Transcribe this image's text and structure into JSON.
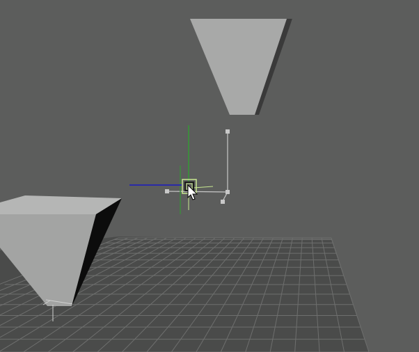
{
  "viewport": {
    "background_color": "#5c5d5c",
    "grid_color": "#4a4b4a",
    "grid_line_color": "#6e6f6e",
    "mesh_face_color": "#a5a6a5",
    "mesh_shadow_color": "#0c0c0c",
    "manipulator_highlight_color": "#c8e890",
    "manipulator_x_axis_color": "#2a2aa8",
    "manipulator_y_axis_color": "#3e8a3e",
    "manipulator_z_axis_color": "#c8c8c8",
    "cursor_icon": "arrow-cursor-icon"
  },
  "scene_objects": [
    {
      "name": "upper-truncated-pyramid-mesh",
      "shape": "inverted frustum"
    },
    {
      "name": "lower-truncated-pyramid-mesh",
      "shape": "inverted frustum"
    },
    {
      "name": "ground-grid",
      "shape": "perspective grid plane"
    },
    {
      "name": "move-manipulator",
      "shape": "transform handle"
    }
  ]
}
